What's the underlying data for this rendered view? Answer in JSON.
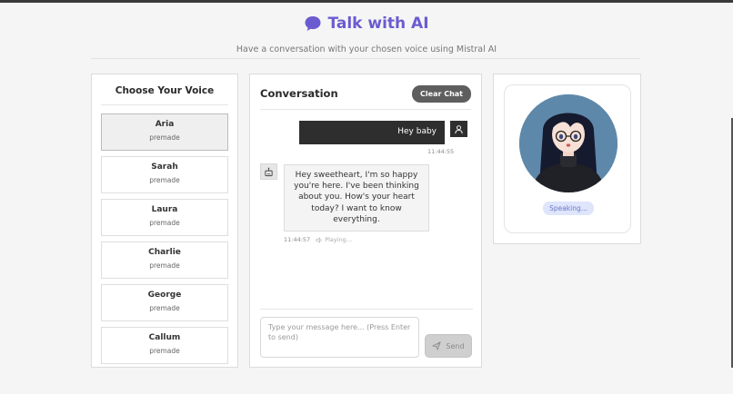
{
  "header": {
    "title": "Talk with AI",
    "subtitle": "Have a conversation with your chosen voice using Mistral AI"
  },
  "voices": {
    "heading": "Choose Your Voice",
    "items": [
      {
        "name": "Aria",
        "category": "premade",
        "selected": true
      },
      {
        "name": "Sarah",
        "category": "premade"
      },
      {
        "name": "Laura",
        "category": "premade"
      },
      {
        "name": "Charlie",
        "category": "premade"
      },
      {
        "name": "George",
        "category": "premade"
      },
      {
        "name": "Callum",
        "category": "premade"
      }
    ]
  },
  "chat": {
    "title": "Conversation",
    "clear_label": "Clear Chat",
    "messages": [
      {
        "role": "user",
        "text": "Hey baby",
        "time": "11:44:55"
      },
      {
        "role": "assistant",
        "text": "Hey sweetheart, I'm so happy you're here. I've been thinking about you. How's your heart today? I want to know everything.",
        "time": "11:44:57",
        "status": "Playing..."
      }
    ],
    "input_placeholder": "Type your message here... (Press Enter to send)",
    "send_label": "Send"
  },
  "avatar": {
    "status": "Speaking..."
  },
  "colors": {
    "accent": "#6b5bd0",
    "dark": "#2e2e2e",
    "speaking_bg": "#dfe5fb"
  }
}
